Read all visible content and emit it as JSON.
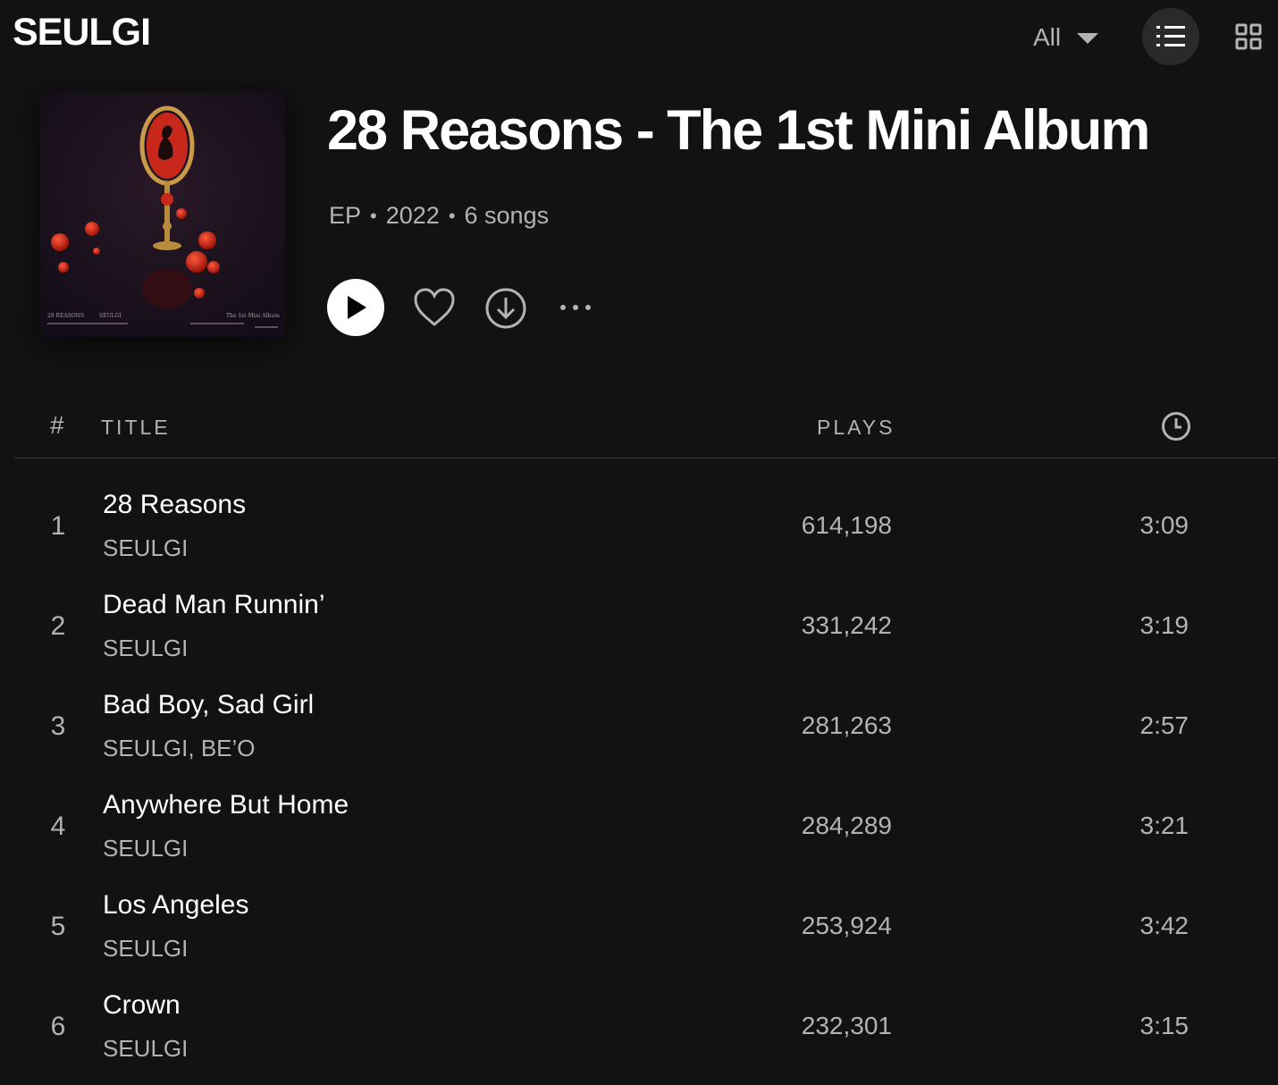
{
  "header": {
    "artist": "SEULGI",
    "filter_label": "All",
    "icons": {
      "filter": "caret-down-icon",
      "list_view": "list-view-icon",
      "grid_view": "grid-view-icon"
    }
  },
  "album": {
    "title": "28 Reasons - The 1st Mini Album",
    "type": "EP",
    "year": "2022",
    "song_count": "6 songs",
    "separator": "•",
    "cover_icon": "album-cover-art",
    "cover_text": [
      "28 REASONS",
      "SEULGI",
      "The 1st Mini Album"
    ]
  },
  "actions": {
    "play_icon": "play-icon",
    "like_icon": "heart-icon",
    "download_icon": "download-icon",
    "more_icon": "more-options-icon"
  },
  "table": {
    "headers": {
      "num": "#",
      "title": "TITLE",
      "plays": "PLAYS",
      "duration_icon": "clock-icon"
    },
    "tracks": [
      {
        "num": "1",
        "title": "28 Reasons",
        "artist": "SEULGI",
        "plays": "614,198",
        "duration": "3:09"
      },
      {
        "num": "2",
        "title": "Dead Man Runnin’",
        "artist": "SEULGI",
        "plays": "331,242",
        "duration": "3:19"
      },
      {
        "num": "3",
        "title": "Bad Boy, Sad Girl",
        "artist": "SEULGI, BE’O",
        "plays": "281,263",
        "duration": "2:57"
      },
      {
        "num": "4",
        "title": "Anywhere But Home",
        "artist": "SEULGI",
        "plays": "284,289",
        "duration": "3:21"
      },
      {
        "num": "5",
        "title": "Los Angeles",
        "artist": "SEULGI",
        "plays": "253,924",
        "duration": "3:42"
      },
      {
        "num": "6",
        "title": "Crown",
        "artist": "SEULGI",
        "plays": "232,301",
        "duration": "3:15"
      }
    ]
  },
  "colors": {
    "background": "#121212",
    "primary_text": "#ffffff",
    "secondary_text": "#b3b3b3",
    "active_button_bg": "#2a2a2a"
  }
}
